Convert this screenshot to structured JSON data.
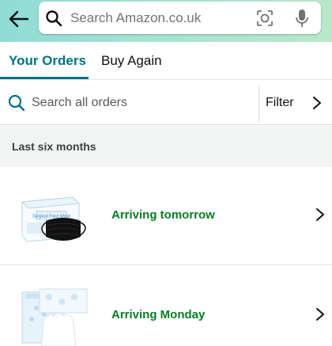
{
  "header": {
    "search_placeholder": "Search Amazon.co.uk",
    "icons": [
      "back-arrow-icon",
      "search-icon",
      "camera-lens-icon",
      "microphone-icon"
    ]
  },
  "tabs": [
    {
      "label": "Your Orders",
      "active": true
    },
    {
      "label": "Buy Again",
      "active": false
    }
  ],
  "order_search": {
    "placeholder": "Search all orders",
    "filter_label": "Filter"
  },
  "section": {
    "title": "Last six months"
  },
  "orders": [
    {
      "status": "Arriving tomorrow",
      "product_icon": "surgical-face-mask-box"
    },
    {
      "status": "Arriving Monday",
      "product_icon": "tissue-pack"
    }
  ],
  "colors": {
    "accent_teal": "#007185",
    "status_green": "#067d22",
    "header_gradient_start": "#8fdcd6",
    "header_gradient_end": "#b9e7c9",
    "section_bg": "#f2f3f3",
    "mask_box_text": "#2e7fb8",
    "mask_label_box": "#e8f3fb"
  },
  "product_box_text": {
    "mask_box": "Surgical Face Mask"
  }
}
